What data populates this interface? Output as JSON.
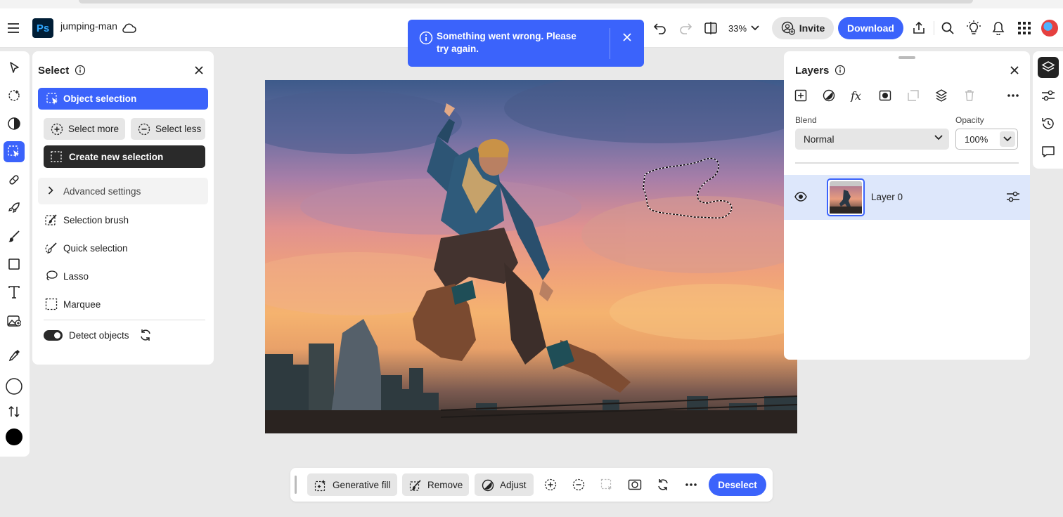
{
  "app": {
    "logo_text": "Ps",
    "document_name": "jumping-man",
    "zoom": "33%",
    "invite_label": "Invite",
    "download_label": "Download",
    "accent_color": "#3b63fb"
  },
  "toast": {
    "message": "Something went wrong. Please try again.",
    "icon": "info-icon"
  },
  "left_toolbar": {
    "tools": [
      "move-tool",
      "select-subject-tool",
      "adjust-tool",
      "selection-tool",
      "heal-tool",
      "quick-actions-tool",
      "brush-tool",
      "shape-tool",
      "type-tool",
      "add-image-tool",
      "eyedropper-tool",
      "background-color",
      "swap-colors",
      "foreground-color"
    ],
    "active_tool": "selection-tool"
  },
  "select_panel": {
    "title": "Select",
    "object_selection": "Object selection",
    "select_more": "Select more",
    "select_less": "Select less",
    "create_new_selection": "Create new selection",
    "advanced_settings": "Advanced settings",
    "items": [
      "Selection brush",
      "Quick selection",
      "Lasso",
      "Marquee"
    ],
    "detect_objects": "Detect objects",
    "detect_objects_on": true
  },
  "layers_panel": {
    "title": "Layers",
    "blend_label": "Blend",
    "blend_value": "Normal",
    "opacity_label": "Opacity",
    "opacity_value": "100%",
    "layers": [
      {
        "name": "Layer 0",
        "visible": true,
        "selected": true
      }
    ]
  },
  "bottom_bar": {
    "generative_fill": "Generative fill",
    "remove": "Remove",
    "adjust": "Adjust",
    "deselect": "Deselect"
  }
}
